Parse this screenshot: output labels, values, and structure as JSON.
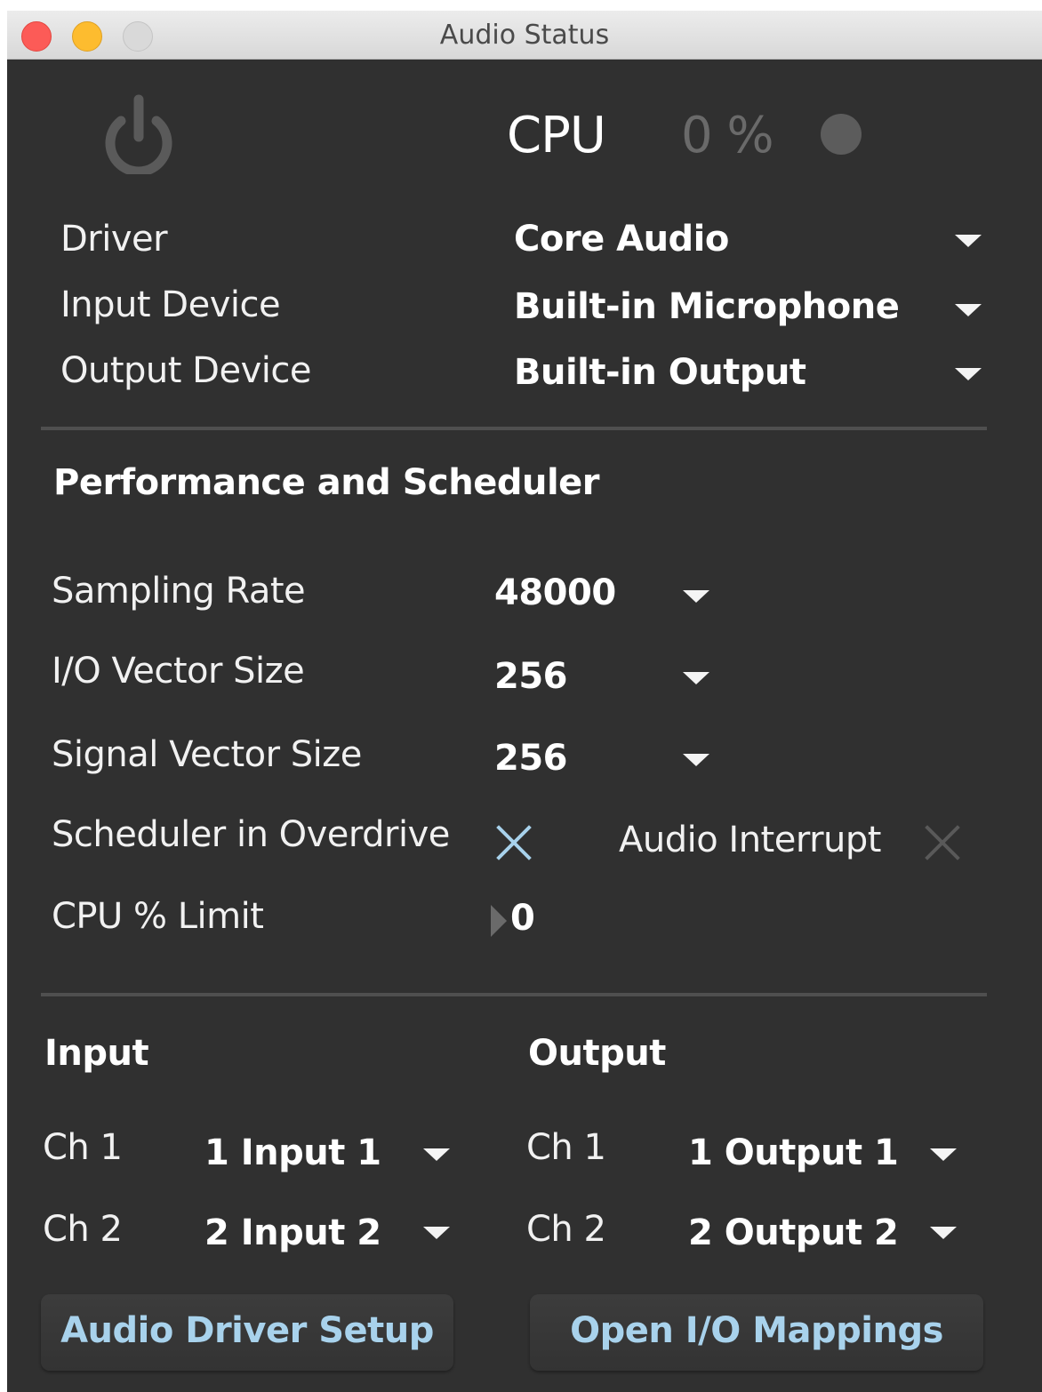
{
  "window": {
    "title": "Audio Status"
  },
  "top": {
    "cpu_label": "CPU",
    "cpu_value": "0 %"
  },
  "devices": [
    {
      "label": "Driver",
      "value": "Core Audio"
    },
    {
      "label": "Input Device",
      "value": "Built-in Microphone"
    },
    {
      "label": "Output Device",
      "value": "Built-in Output"
    }
  ],
  "performance": {
    "heading": "Performance and Scheduler",
    "sampling_rate": {
      "label": "Sampling Rate",
      "value": "48000"
    },
    "io_vector": {
      "label": "I/O Vector Size",
      "value": "256"
    },
    "signal_vector": {
      "label": "Signal Vector Size",
      "value": "256"
    },
    "overdrive": {
      "label": "Scheduler in Overdrive",
      "enabled": true
    },
    "interrupt": {
      "label": "Audio Interrupt",
      "enabled": false
    },
    "cpu_limit": {
      "label": "CPU % Limit",
      "value": "0"
    }
  },
  "io": {
    "input_heading": "Input",
    "output_heading": "Output",
    "inputs": [
      {
        "channel": "Ch 1",
        "value": "1 Input 1"
      },
      {
        "channel": "Ch 2",
        "value": "2 Input 2"
      }
    ],
    "outputs": [
      {
        "channel": "Ch 1",
        "value": "1 Output 1"
      },
      {
        "channel": "Ch 2",
        "value": "2 Output 2"
      }
    ]
  },
  "buttons": {
    "driver_setup": "Audio Driver Setup",
    "io_mappings": "Open I/O Mappings"
  },
  "colors": {
    "background": "#303030",
    "accent": "#a8d2ec",
    "muted": "#595959"
  }
}
